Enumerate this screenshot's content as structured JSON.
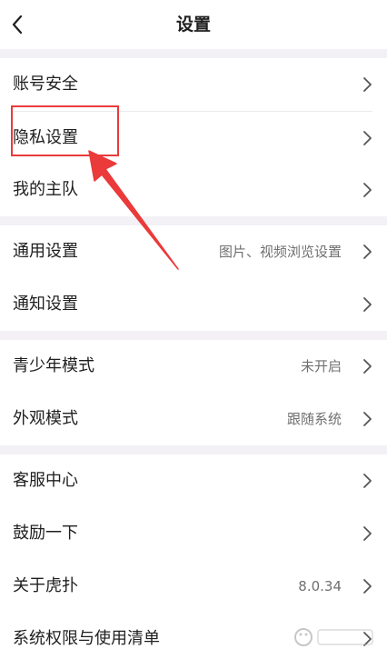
{
  "header": {
    "title": "设置",
    "back_icon": "chevron-left-icon"
  },
  "sections": [
    {
      "items": [
        {
          "label": "账号安全",
          "value": ""
        },
        {
          "label": "隐私设置",
          "value": ""
        },
        {
          "label": "我的主队",
          "value": ""
        }
      ]
    },
    {
      "items": [
        {
          "label": "通用设置",
          "value": "图片、视频浏览设置"
        },
        {
          "label": "通知设置",
          "value": ""
        }
      ]
    },
    {
      "items": [
        {
          "label": "青少年模式",
          "value": "未开启"
        },
        {
          "label": "外观模式",
          "value": "跟随系统"
        }
      ]
    },
    {
      "items": [
        {
          "label": "客服中心",
          "value": ""
        },
        {
          "label": "鼓励一下",
          "value": ""
        },
        {
          "label": "关于虎扑",
          "value": "8.0.34"
        },
        {
          "label": "系统权限与使用清单",
          "value": ""
        }
      ]
    }
  ],
  "annotation": {
    "highlight_color": "#ea3a3a",
    "highlight_icon": "red-box-annotation",
    "arrow_icon": "red-arrow-annotation"
  },
  "colors": {
    "section_gap": "#f3f1f6",
    "text": "#1f1f1f",
    "value_text": "#707070",
    "chevron": "#555555"
  }
}
